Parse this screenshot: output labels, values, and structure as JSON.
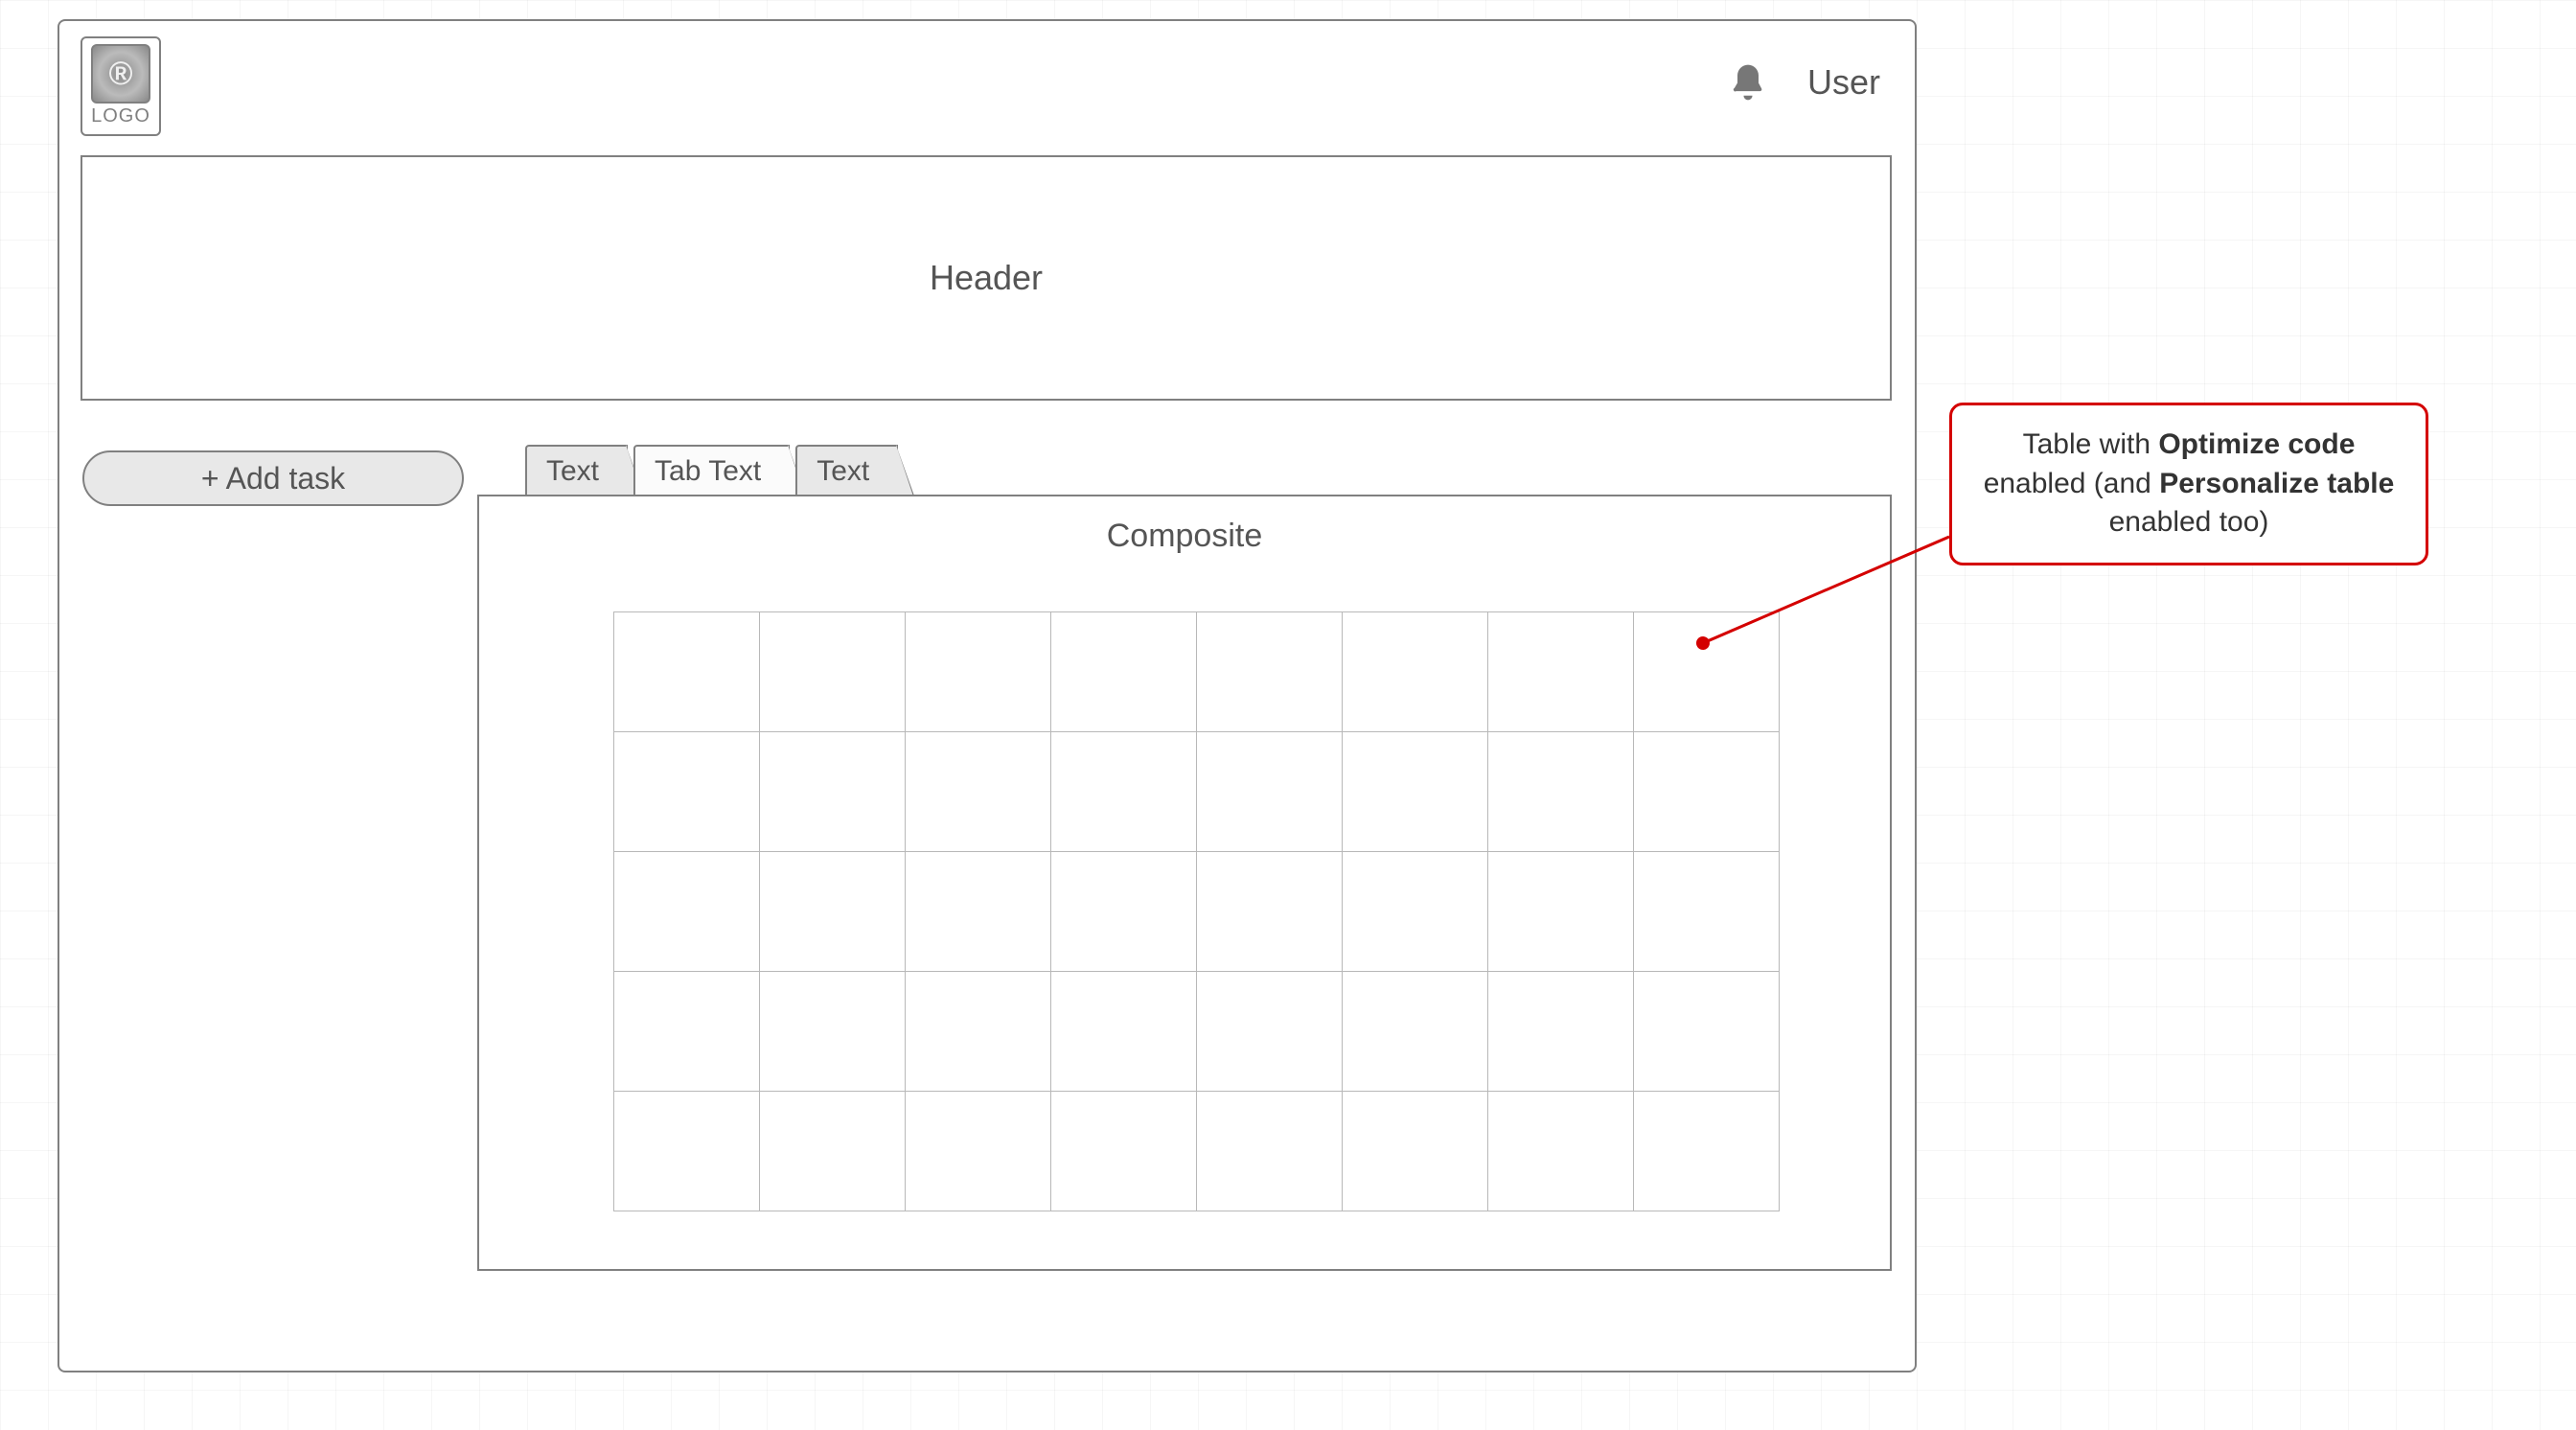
{
  "logo": {
    "glyph": "®",
    "label": "LOGO"
  },
  "topbar": {
    "user_label": "User"
  },
  "header": {
    "title": "Header"
  },
  "toolbar": {
    "add_task_label": "+ Add task"
  },
  "tabs": [
    {
      "label": "Text",
      "active": false
    },
    {
      "label": "Tab Text",
      "active": true
    },
    {
      "label": "Text",
      "active": false
    }
  ],
  "composite": {
    "title": "Composite",
    "grid": {
      "rows": 5,
      "cols": 8
    }
  },
  "annotation": {
    "lead": "Table with ",
    "bold1": "Optimize code",
    "mid": " enabled (and ",
    "bold2": "Personalize table",
    "tail": " enabled too)"
  }
}
